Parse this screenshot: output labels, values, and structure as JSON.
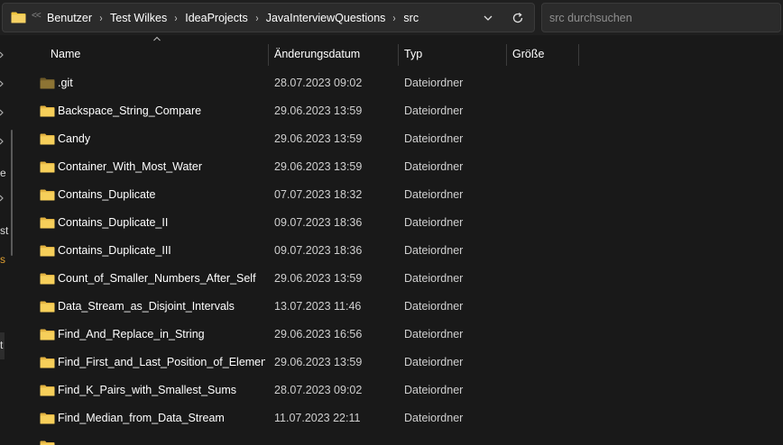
{
  "addressbar": {
    "overflow_symbol": "<<",
    "breadcrumbs": [
      "Benutzer",
      "Test Wilkes",
      "IdeaProjects",
      "JavaInterviewQuestions",
      "src"
    ],
    "separator": "›"
  },
  "search": {
    "placeholder": "src durchsuchen",
    "value": ""
  },
  "nav": {
    "fragments": [
      "e",
      "st",
      "s",
      "t"
    ]
  },
  "columns": {
    "name": "Name",
    "date": "Änderungsdatum",
    "type": "Typ",
    "size": "Größe"
  },
  "rows": [
    {
      "name": ".git",
      "date": "28.07.2023 09:02",
      "type": "Dateiordner",
      "hidden": true
    },
    {
      "name": "Backspace_String_Compare",
      "date": "29.06.2023 13:59",
      "type": "Dateiordner"
    },
    {
      "name": "Candy",
      "date": "29.06.2023 13:59",
      "type": "Dateiordner"
    },
    {
      "name": "Container_With_Most_Water",
      "date": "29.06.2023 13:59",
      "type": "Dateiordner"
    },
    {
      "name": "Contains_Duplicate",
      "date": "07.07.2023 18:32",
      "type": "Dateiordner"
    },
    {
      "name": "Contains_Duplicate_II",
      "date": "09.07.2023 18:36",
      "type": "Dateiordner"
    },
    {
      "name": "Contains_Duplicate_III",
      "date": "09.07.2023 18:36",
      "type": "Dateiordner"
    },
    {
      "name": "Count_of_Smaller_Numbers_After_Self",
      "date": "29.06.2023 13:59",
      "type": "Dateiordner"
    },
    {
      "name": "Data_Stream_as_Disjoint_Intervals",
      "date": "13.07.2023 11:46",
      "type": "Dateiordner"
    },
    {
      "name": "Find_And_Replace_in_String",
      "date": "29.06.2023 16:56",
      "type": "Dateiordner"
    },
    {
      "name": "Find_First_and_Last_Position_of_Element...",
      "date": "29.06.2023 13:59",
      "type": "Dateiordner"
    },
    {
      "name": "Find_K_Pairs_with_Smallest_Sums",
      "date": "28.07.2023 09:02",
      "type": "Dateiordner"
    },
    {
      "name": "Find_Median_from_Data_Stream",
      "date": "11.07.2023 22:11",
      "type": "Dateiordner"
    }
  ],
  "colors": {
    "background": "#191919",
    "folder": "#f0c53d",
    "folder_hidden": "#8d7434",
    "text": "#ffffff",
    "secondary_text": "#cfcfcf"
  },
  "icons": {
    "folder": "folder-icon",
    "dropdown": "chevron-down-icon",
    "refresh": "refresh-icon"
  }
}
